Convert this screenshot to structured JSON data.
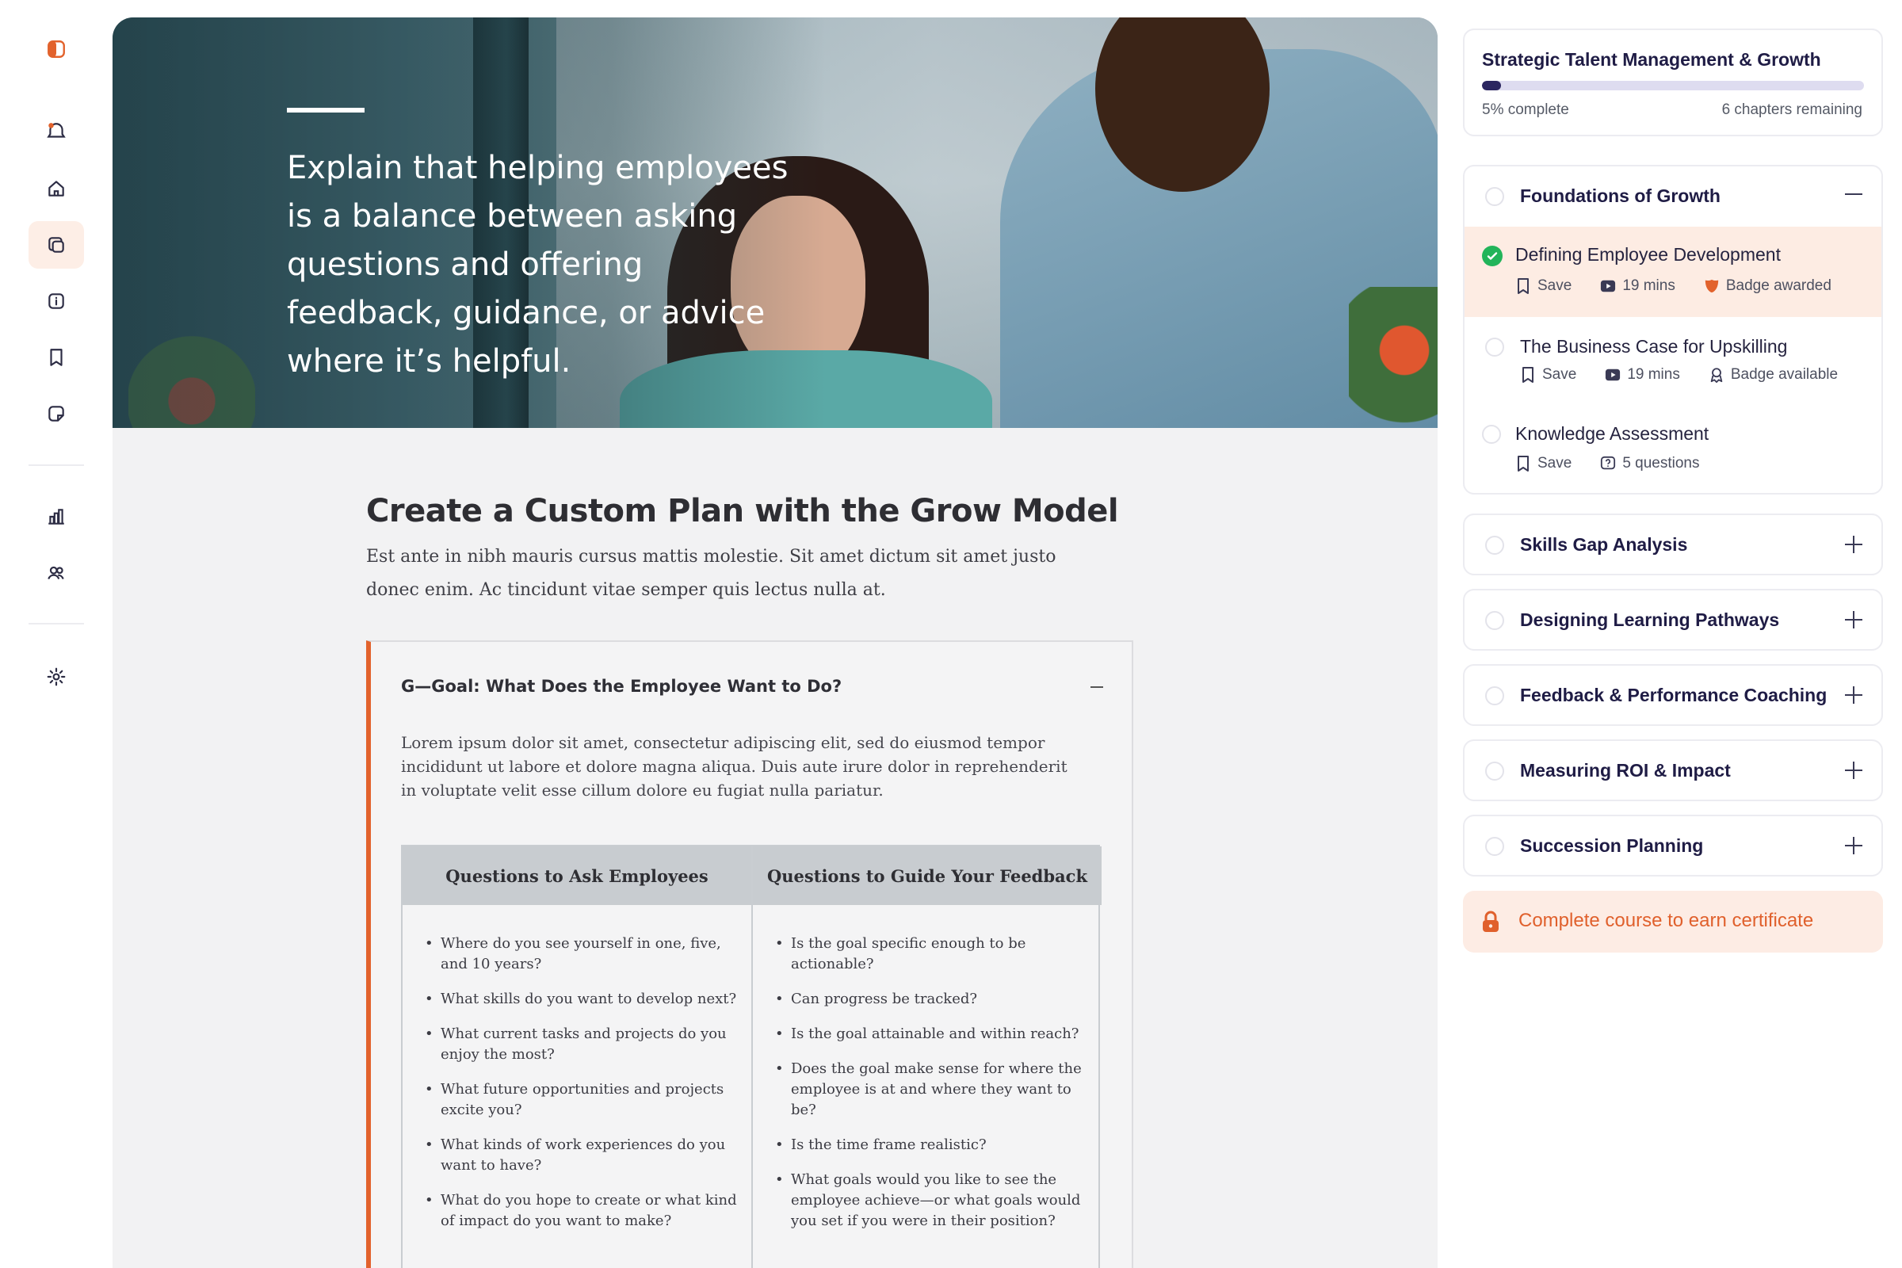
{
  "hero": {
    "quote": "Explain that helping employees is a balance between asking questions and offering feedback, guidance, or advice where it’s helpful."
  },
  "article": {
    "title": "Create a Custom Plan with the Grow Model",
    "lead": "Est ante in nibh mauris cursus mattis molestie. Sit amet dictum sit amet justo donec enim. Ac tincidunt vitae semper quis lectus nulla at."
  },
  "accordion": {
    "heading": "G—Goal: What Does the Employee Want to Do?",
    "body": "Lorem ipsum dolor sit amet, consectetur adipiscing elit, sed do eiusmod tempor incididunt ut labore et dolore magna aliqua. Duis aute irure dolor in reprehenderit in voluptate velit esse cillum dolore eu fugiat nulla pariatur.",
    "table": {
      "headers": [
        "Questions to Ask Employees",
        "Questions to Guide Your Feedback"
      ],
      "left": [
        "Where do you see yourself in one, five, and 10 years?",
        "What skills do you want to develop next?",
        "What current tasks and projects do you enjoy the most?",
        "What future opportunities and projects excite you?",
        "What kinds of work experiences do you want to have?",
        "What do you hope to create or what kind of impact do you want to make?"
      ],
      "right": [
        "Is the goal specific enough to be actionable?",
        "Can progress be tracked?",
        "Is the goal attainable and within reach?",
        "Does the goal make sense for where the employee is at and where they want to be?",
        "Is the time frame realistic?",
        "What goals would you like to see the employee achieve—or what goals would you set if you were in their position?"
      ]
    }
  },
  "course": {
    "title": "Strategic Talent Management & Growth",
    "progress": 0.05,
    "progress_label": "5% complete",
    "remaining_label": "6 chapters remaining"
  },
  "chapters": [
    {
      "title": "Foundations of Growth",
      "expanded": true,
      "lessons": [
        {
          "title": "Defining Employee Development",
          "save": "Save",
          "duration": "19 mins",
          "badge": "Badge awarded",
          "done": true
        },
        {
          "title": "The Business Case for Upskilling",
          "save": "Save",
          "duration": "19 mins",
          "badge": "Badge available",
          "done": false
        },
        {
          "title": "Knowledge Assessment",
          "save": "Save",
          "questions": "5 questions",
          "done": false
        }
      ]
    },
    {
      "title": "Skills Gap Analysis",
      "expanded": false
    },
    {
      "title": "Designing Learning Pathways",
      "expanded": false
    },
    {
      "title": "Feedback & Performance Coaching",
      "expanded": false
    },
    {
      "title": "Measuring ROI & Impact",
      "expanded": false
    },
    {
      "title": "Succession Planning",
      "expanded": false
    }
  ],
  "certificate": {
    "label": "Complete course to earn certificate"
  },
  "colors": {
    "accent": "#e2622c",
    "navy": "#2b2660",
    "success": "#22b45a"
  },
  "rail_icons": [
    "logo-icon",
    "notifications-icon",
    "home-icon",
    "courses-icon",
    "info-icon",
    "bookmark-icon",
    "notes-icon",
    "analytics-icon",
    "team-icon",
    "settings-icon"
  ]
}
